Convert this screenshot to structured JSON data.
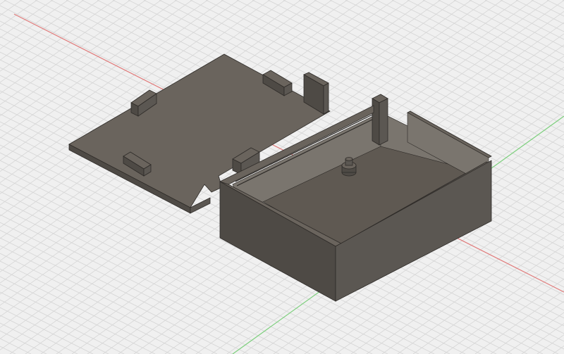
{
  "viewport": {
    "background": "#f0f0f0",
    "grid_line_color": "#d6d6d6",
    "axis_colors": {
      "x_axis": "#e07a7a",
      "y_axis": "#7ccf7c"
    }
  },
  "model": {
    "parts": [
      "lid-plate",
      "enclosure-box"
    ],
    "colors": {
      "top_face": "#6a645d",
      "side_face_dark": "#4e4a45",
      "side_face_mid": "#5b5752",
      "interior_floor": "#5f5952",
      "interior_wall": "#7a756e",
      "edge": "#2e2b28"
    }
  }
}
